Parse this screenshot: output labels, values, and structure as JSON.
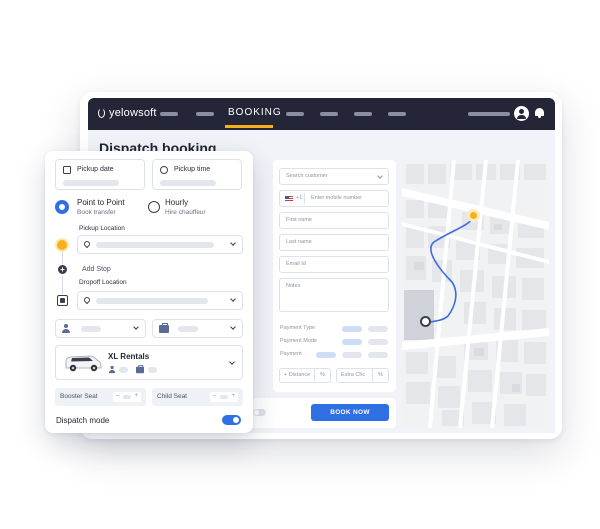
{
  "app": {
    "brand": "yelowsoft",
    "active_nav": "BOOKING"
  },
  "page": {
    "title": "Dispatch booking"
  },
  "customer_form": {
    "search_placeholder": "Search customer",
    "phone_code": "+1",
    "phone_placeholder": "Enter mobile number",
    "first_name_placeholder": "First name",
    "last_name_placeholder": "Last name",
    "email_placeholder": "Email Id",
    "notes_placeholder": "Notes",
    "payment_type_label": "Payment Type",
    "payment_mode_label": "Payment Mode",
    "payment_label": "Payment",
    "distance_label": "+ Distance",
    "distance_unit": "%",
    "extra_charge_label": "Extra Chc",
    "extra_charge_unit": "%",
    "book_button": "BOOK NOW"
  },
  "booking_panel": {
    "pickup_date_label": "Pickup date",
    "pickup_time_label": "Pickup time",
    "options": [
      {
        "title": "Point to Point",
        "subtitle": "Book transfer",
        "selected": true
      },
      {
        "title": "Hourly",
        "subtitle": "Hire chauffeur",
        "selected": false
      }
    ],
    "pickup_location_label": "Pickup Location",
    "add_stop_label": "Add Stop",
    "dropoff_location_label": "Dropoff Location",
    "vehicle": {
      "name": "XL Rentals"
    },
    "booster_seat_label": "Booster Seat",
    "child_seat_label": "Child Seat",
    "dispatch_mode_label": "Dispatch mode",
    "dispatch_mode_on": true
  },
  "colors": {
    "accent_blue": "#2f6fe4",
    "accent_yellow": "#f5b119",
    "nav_dark": "#242637"
  },
  "icons": [
    "calendar-icon",
    "clock-icon",
    "pin-icon",
    "plus-icon",
    "person-icon",
    "luggage-icon",
    "car-icon",
    "user-icon",
    "bell-icon",
    "chevron-down-icon",
    "flag-icon"
  ]
}
